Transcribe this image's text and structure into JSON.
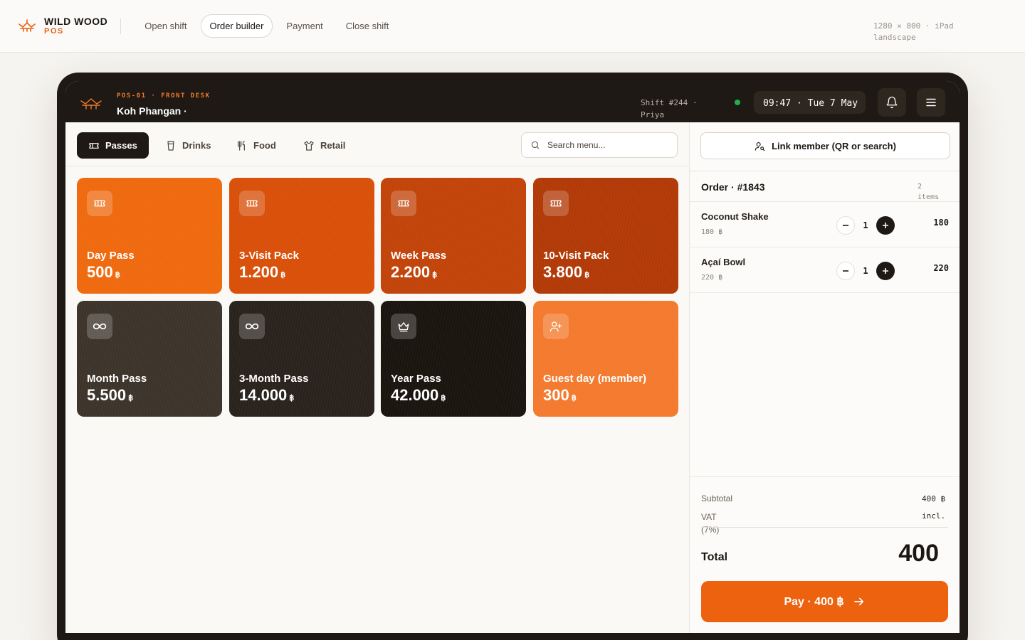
{
  "app": {
    "brand_name": "WILD WOOD",
    "brand_sub": "POS",
    "nav": [
      {
        "label": "Open shift",
        "active": false
      },
      {
        "label": "Order builder",
        "active": true
      },
      {
        "label": "Payment",
        "active": false
      },
      {
        "label": "Close shift",
        "active": false
      }
    ],
    "device_note": "1280 × 800 · iPad landscape"
  },
  "pos": {
    "terminal": "POS-01 · FRONT DESK",
    "location": "Koh Phangan ·",
    "shift": "Shift #244 · Priya",
    "clock": "09:47 · Tue 7 May",
    "status_color": "#22b04b",
    "icons": {
      "notifications": "bell-icon",
      "menu": "menu-icon"
    }
  },
  "categories": [
    {
      "label": "Passes",
      "icon": "ticket-icon",
      "active": true
    },
    {
      "label": "Drinks",
      "icon": "cup-icon",
      "active": false
    },
    {
      "label": "Food",
      "icon": "utensils-icon",
      "active": false
    },
    {
      "label": "Retail",
      "icon": "shirt-icon",
      "active": false
    }
  ],
  "search": {
    "placeholder": "Search menu..."
  },
  "tiles": [
    {
      "name": "Day Pass",
      "price": "500",
      "currency": "฿",
      "icon": "ticket-icon",
      "color": "#ef6a0f"
    },
    {
      "name": "3-Visit Pack",
      "price": "1.200",
      "currency": "฿",
      "icon": "ticket-icon",
      "color": "#d9500a"
    },
    {
      "name": "Week Pass",
      "price": "2.200",
      "currency": "฿",
      "icon": "ticket-icon",
      "color": "#c2440a"
    },
    {
      "name": "10-Visit Pack",
      "price": "3.800",
      "currency": "฿",
      "icon": "ticket-icon",
      "color": "#b23a08"
    },
    {
      "name": "Month Pass",
      "price": "5.500",
      "currency": "฿",
      "icon": "infinity-icon",
      "color": "#3d342b"
    },
    {
      "name": "3-Month Pass",
      "price": "14.000",
      "currency": "฿",
      "icon": "infinity-icon",
      "color": "#2a221c"
    },
    {
      "name": "Year Pass",
      "price": "42.000",
      "currency": "฿",
      "icon": "crown-icon",
      "color": "#1b1510"
    },
    {
      "name": "Guest day (member)",
      "price": "300",
      "currency": "฿",
      "icon": "user-plus-icon",
      "color": "#f37a2e"
    }
  ],
  "order": {
    "link_member": "Link member (QR or search)",
    "title": "Order · #1843",
    "count": "2 items",
    "lines": [
      {
        "name": "Coconut Shake",
        "unit": "180 ฿",
        "qty": "1",
        "total": "180"
      },
      {
        "name": "Açaí Bowl",
        "unit": "220 ฿",
        "qty": "1",
        "total": "220"
      }
    ],
    "subtotal_label": "Subtotal",
    "subtotal_value": "400 ฿",
    "vat_label": "VAT (7%)",
    "vat_value": "incl.",
    "total_label": "Total",
    "total_value": "400",
    "pay_label": "Pay · 400 ฿"
  }
}
